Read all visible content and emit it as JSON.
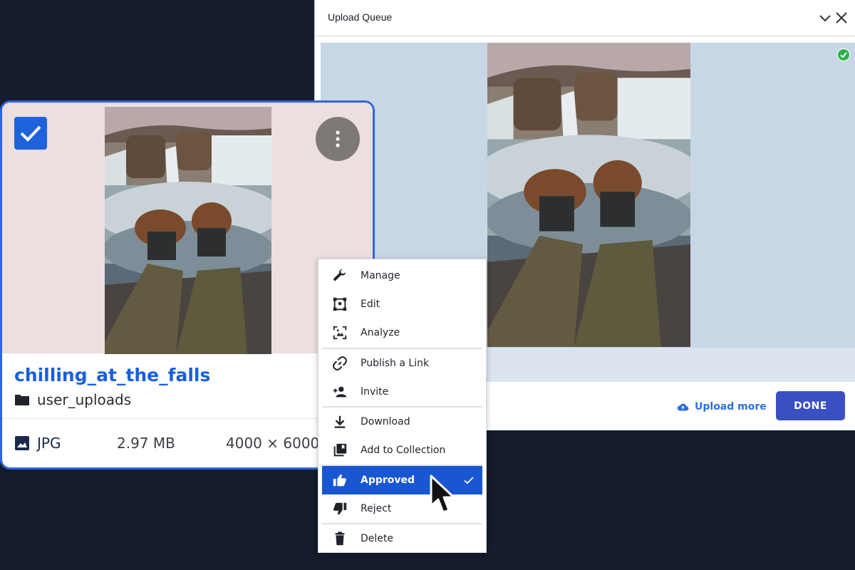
{
  "queue": {
    "title": "Upload Queue",
    "collapse_icon": "chevron-down-icon",
    "close_icon": "close-icon",
    "upload_more_label": "Upload more",
    "done_label": "DONE",
    "status": "uploaded"
  },
  "card": {
    "selected": true,
    "title": "chilling_at_the_falls",
    "folder": "user_uploads",
    "file_type": "JPG",
    "file_size": "2.97 MB",
    "dimensions": "4000 × 6000"
  },
  "menu": {
    "groups": [
      [
        {
          "label": "Manage",
          "icon": "wrench-icon"
        },
        {
          "label": "Edit",
          "icon": "edit-frame-icon"
        },
        {
          "label": "Analyze",
          "icon": "analyze-icon"
        }
      ],
      [
        {
          "label": "Publish a Link",
          "icon": "link-icon"
        },
        {
          "label": "Invite",
          "icon": "person-add-icon"
        }
      ],
      [
        {
          "label": "Download",
          "icon": "download-icon"
        },
        {
          "label": "Add to Collection",
          "icon": "collection-icon"
        }
      ],
      [
        {
          "label": "Approved",
          "icon": "thumbs-up-icon",
          "active": true
        },
        {
          "label": "Reject",
          "icon": "thumbs-down-icon"
        }
      ],
      [
        {
          "label": "Delete",
          "icon": "trash-icon"
        }
      ]
    ]
  },
  "colors": {
    "accent": "#1957d2",
    "done_button": "#3a4fc2",
    "background": "#141c2e",
    "link": "#2f6fd8",
    "success": "#2bb24c"
  }
}
